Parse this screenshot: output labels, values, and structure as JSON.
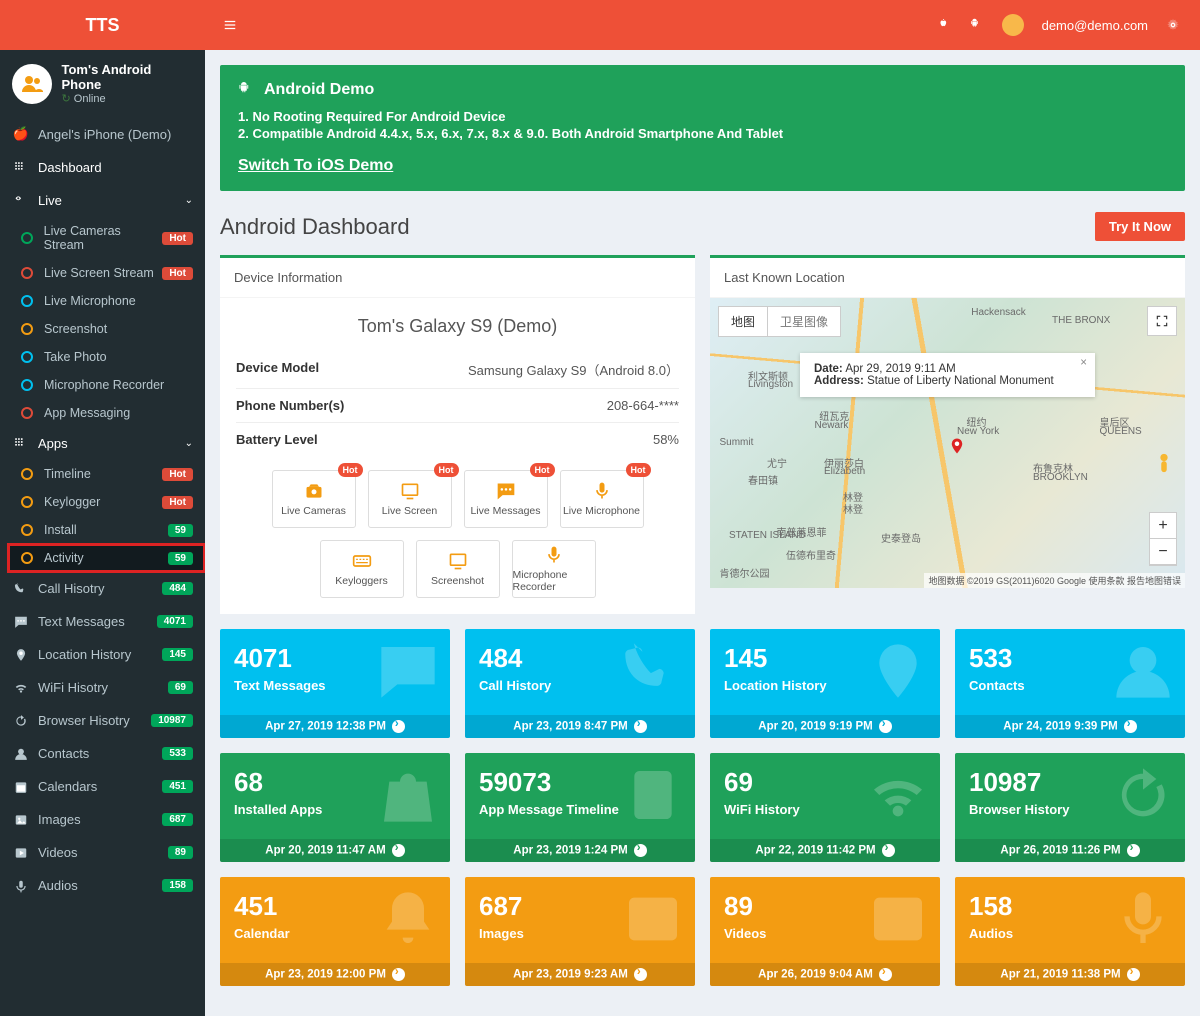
{
  "header": {
    "logo": "TTS",
    "user_email": "demo@demo.com"
  },
  "user_panel": {
    "name": "Tom's Android Phone",
    "status": "Online"
  },
  "sidebar": {
    "demo_device": "Angel's iPhone (Demo)",
    "dashboard": "Dashboard",
    "live": {
      "label": "Live",
      "items": [
        {
          "label": "Live Cameras Stream",
          "badge": "Hot",
          "btype": "b-red",
          "ring": "r-g"
        },
        {
          "label": "Live Screen Stream",
          "badge": "Hot",
          "btype": "b-red",
          "ring": "r-r"
        },
        {
          "label": "Live Microphone",
          "ring": "r-b"
        },
        {
          "label": "Screenshot",
          "ring": "r-o"
        },
        {
          "label": "Take Photo",
          "ring": "r-b"
        },
        {
          "label": "Microphone Recorder",
          "ring": "r-b"
        },
        {
          "label": "App Messaging",
          "ring": "r-r"
        }
      ]
    },
    "apps": {
      "label": "Apps",
      "items": [
        {
          "label": "Timeline",
          "badge": "Hot",
          "btype": "b-red",
          "ring": "r-o"
        },
        {
          "label": "Keylogger",
          "badge": "Hot",
          "btype": "b-red",
          "ring": "r-o"
        },
        {
          "label": "Install",
          "badge": "59",
          "btype": "b-grn",
          "ring": "r-o"
        },
        {
          "label": "Activity",
          "badge": "59",
          "btype": "b-grn",
          "ring": "r-o",
          "hl": true
        }
      ]
    },
    "rest": [
      {
        "label": "Call Hisotry",
        "badge": "484",
        "btype": "b-grn",
        "icon": "phone"
      },
      {
        "label": "Text Messages",
        "badge": "4071",
        "btype": "b-grn",
        "icon": "chat"
      },
      {
        "label": "Location History",
        "badge": "145",
        "btype": "b-grn",
        "icon": "pin"
      },
      {
        "label": "WiFi Hisotry",
        "badge": "69",
        "btype": "b-grn",
        "icon": "wifi"
      },
      {
        "label": "Browser Hisotry",
        "badge": "10987",
        "btype": "b-grn",
        "icon": "refresh"
      },
      {
        "label": "Contacts",
        "badge": "533",
        "btype": "b-grn",
        "icon": "user"
      },
      {
        "label": "Calendars",
        "badge": "451",
        "btype": "b-grn",
        "icon": "calendar"
      },
      {
        "label": "Images",
        "badge": "687",
        "btype": "b-grn",
        "icon": "image"
      },
      {
        "label": "Videos",
        "badge": "89",
        "btype": "b-grn",
        "icon": "video"
      },
      {
        "label": "Audios",
        "badge": "158",
        "btype": "b-grn",
        "icon": "audio"
      }
    ]
  },
  "banner": {
    "title": "Android Demo",
    "line1": "1. No Rooting Required For Android Device",
    "line2": "2. Compatible Android 4.4.x, 5.x, 6.x, 7.x, 8.x & 9.0. Both Android Smartphone And Tablet",
    "link": "Switch To iOS Demo"
  },
  "page": {
    "title": "Android Dashboard",
    "try": "Try It Now"
  },
  "device": {
    "box_title": "Device Information",
    "name": "Tom's Galaxy S9 (Demo)",
    "rows": [
      {
        "k": "Device Model",
        "v": "Samsung Galaxy S9（Android 8.0）"
      },
      {
        "k": "Phone Number(s)",
        "v": "208-664-****"
      },
      {
        "k": "Battery Level",
        "v": "58%"
      }
    ],
    "buttons": [
      {
        "label": "Live Cameras",
        "hot": true,
        "icon": "camera"
      },
      {
        "label": "Live Screen",
        "hot": true,
        "icon": "screen"
      },
      {
        "label": "Live Messages",
        "hot": true,
        "icon": "chat"
      },
      {
        "label": "Live Microphone",
        "hot": true,
        "icon": "mic"
      },
      {
        "label": "Keyloggers",
        "icon": "keyboard"
      },
      {
        "label": "Screenshot",
        "icon": "screen"
      },
      {
        "label": "Microphone Recorder",
        "icon": "mic"
      }
    ]
  },
  "map": {
    "box_title": "Last Known Location",
    "tab_map": "地图",
    "tab_sat": "卫星图像",
    "info_date_k": "Date:",
    "info_date_v": "Apr 29, 2019 9:11 AM",
    "info_addr_k": "Address:",
    "info_addr_v": "Statue of Liberty National Monument",
    "labels": [
      "Hackensack",
      "THE BRONX",
      "Livingston",
      "Newark",
      "New York",
      "Elizabeth",
      "BROOKLYN",
      "QUEENS",
      "STATEN ISLAND",
      "Summit",
      "利文斯顿",
      "纽瓦克",
      "伊丽莎白",
      "林登",
      "纽约",
      "布鲁克林",
      "尤宁",
      "皇后区",
      "伍德布里奇",
      "史泰登岛",
      "肯德尔公园",
      "南普莱恩菲",
      "林登",
      "春田镇"
    ],
    "attr": "地图数据 ©2019 GS(2011)6020 Google   使用条款   报告地图错误"
  },
  "cards": [
    {
      "num": "4071",
      "lbl": "Text Messages",
      "foot": "Apr 27, 2019 12:38 PM",
      "color": "c-blue",
      "icon": "chat"
    },
    {
      "num": "484",
      "lbl": "Call History",
      "foot": "Apr 23, 2019 8:47 PM",
      "color": "c-blue",
      "icon": "phone"
    },
    {
      "num": "145",
      "lbl": "Location History",
      "foot": "Apr 20, 2019 9:19 PM",
      "color": "c-blue",
      "icon": "pin"
    },
    {
      "num": "533",
      "lbl": "Contacts",
      "foot": "Apr 24, 2019 9:39 PM",
      "color": "c-blue",
      "icon": "user"
    },
    {
      "num": "68",
      "lbl": "Installed Apps",
      "foot": "Apr 20, 2019 11:47 AM",
      "color": "c-grn",
      "icon": "bag"
    },
    {
      "num": "59073",
      "lbl": "App Message Timeline",
      "foot": "Apr 23, 2019 1:24 PM",
      "color": "c-grn",
      "icon": "doc"
    },
    {
      "num": "69",
      "lbl": "WiFi History",
      "foot": "Apr 22, 2019 11:42 PM",
      "color": "c-grn",
      "icon": "wifi"
    },
    {
      "num": "10987",
      "lbl": "Browser History",
      "foot": "Apr 26, 2019 11:26 PM",
      "color": "c-grn",
      "icon": "refresh"
    },
    {
      "num": "451",
      "lbl": "Calendar",
      "foot": "Apr 23, 2019 12:00 PM",
      "color": "c-org",
      "icon": "bell"
    },
    {
      "num": "687",
      "lbl": "Images",
      "foot": "Apr 23, 2019 9:23 AM",
      "color": "c-org",
      "icon": "image"
    },
    {
      "num": "89",
      "lbl": "Videos",
      "foot": "Apr 26, 2019 9:04 AM",
      "color": "c-org",
      "icon": "video"
    },
    {
      "num": "158",
      "lbl": "Audios",
      "foot": "Apr 21, 2019 11:38 PM",
      "color": "c-org",
      "icon": "mic"
    }
  ]
}
